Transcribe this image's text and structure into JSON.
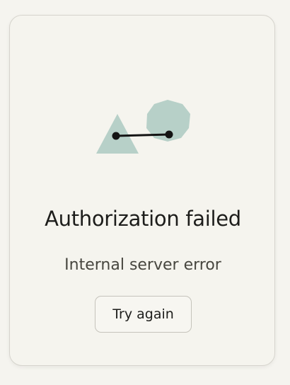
{
  "error": {
    "title": "Authorization failed",
    "message": "Internal server error",
    "retry_label": "Try again",
    "illustration_icon": "disconnected-shapes-icon"
  },
  "colors": {
    "background": "#f5f4ef",
    "shape_fill": "#b7d0c8",
    "connector": "#141414",
    "title_text": "#1d1d1b"
  }
}
